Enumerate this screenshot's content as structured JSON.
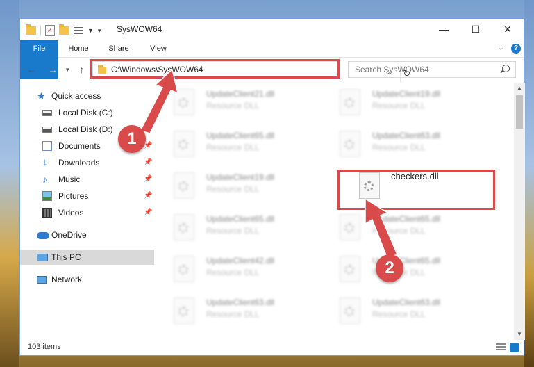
{
  "window": {
    "title": "SysWOW64",
    "minimize_glyph": "—",
    "maximize_glyph": "☐",
    "close_glyph": "✕"
  },
  "ribbon": {
    "tabs": [
      "File",
      "Home",
      "Share",
      "View"
    ],
    "help_glyph": "?"
  },
  "nav": {
    "address": "C:\\Windows\\SysWOW64",
    "search_placeholder": "Search SysWOW64"
  },
  "sidebar": {
    "items": [
      {
        "label": "Quick access",
        "icon": "star-icon"
      },
      {
        "label": "Local Disk (C:)",
        "icon": "drive-icon",
        "pinned": true
      },
      {
        "label": "Local Disk (D:)",
        "icon": "drive-icon",
        "pinned": true
      },
      {
        "label": "Documents",
        "icon": "documents-icon",
        "pinned": true
      },
      {
        "label": "Downloads",
        "icon": "downloads-icon",
        "pinned": true
      },
      {
        "label": "Music",
        "icon": "music-icon",
        "pinned": true
      },
      {
        "label": "Pictures",
        "icon": "pictures-icon",
        "pinned": true
      },
      {
        "label": "Videos",
        "icon": "videos-icon",
        "pinned": true
      },
      {
        "label": "OneDrive",
        "icon": "onedrive-icon"
      },
      {
        "label": "This PC",
        "icon": "this-pc-icon",
        "selected": true
      },
      {
        "label": "Network",
        "icon": "network-icon"
      }
    ]
  },
  "files": [
    {
      "name": "UpdateClient21.dll",
      "type": "Resource DLL"
    },
    {
      "name": "UpdateClient19.dll",
      "type": "Resource DLL"
    },
    {
      "name": "UpdateClient65.dll",
      "type": "Resource DLL"
    },
    {
      "name": "UpdateClient63.dll",
      "type": "Resource DLL"
    },
    {
      "name": "UpdateClient19.dll",
      "type": "Resource DLL"
    },
    {
      "name": "checkers.dll",
      "type": ""
    },
    {
      "name": "UpdateClient65.dll",
      "type": "Resource DLL"
    },
    {
      "name": "UpdateClient65.dll",
      "type": "Resource DLL"
    },
    {
      "name": "UpdateClient42.dll",
      "type": "Resource DLL"
    },
    {
      "name": "UpdateClient65.dll",
      "type": "Resource DLL"
    },
    {
      "name": "UpdateClient63.dll",
      "type": "Resource DLL"
    },
    {
      "name": "UpdateClient63.dll",
      "type": "Resource DLL"
    }
  ],
  "status": {
    "item_count": "103 items"
  },
  "annotations": {
    "step1": "1",
    "step2": "2",
    "highlight_color": "#d94a4a"
  },
  "colors": {
    "accent": "#1979ca"
  }
}
